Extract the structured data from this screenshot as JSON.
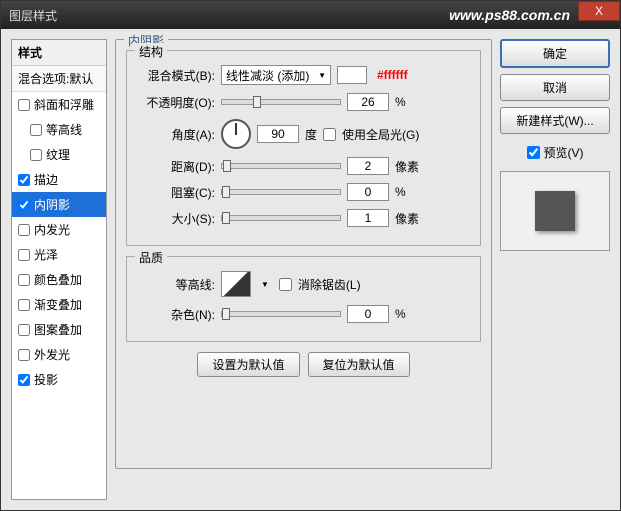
{
  "titlebar": {
    "title": "图层样式",
    "url": "www.ps88.com.cn",
    "close": "X"
  },
  "styles": {
    "header": "样式",
    "blend": "混合选项:默认",
    "items": [
      {
        "label": "斜面和浮雕",
        "checked": false,
        "indent": false
      },
      {
        "label": "等高线",
        "checked": false,
        "indent": true
      },
      {
        "label": "纹理",
        "checked": false,
        "indent": true
      },
      {
        "label": "描边",
        "checked": true,
        "indent": false
      },
      {
        "label": "内阴影",
        "checked": true,
        "indent": false,
        "selected": true
      },
      {
        "label": "内发光",
        "checked": false,
        "indent": false
      },
      {
        "label": "光泽",
        "checked": false,
        "indent": false
      },
      {
        "label": "颜色叠加",
        "checked": false,
        "indent": false
      },
      {
        "label": "渐变叠加",
        "checked": false,
        "indent": false
      },
      {
        "label": "图案叠加",
        "checked": false,
        "indent": false
      },
      {
        "label": "外发光",
        "checked": false,
        "indent": false
      },
      {
        "label": "投影",
        "checked": true,
        "indent": false
      }
    ]
  },
  "panel": {
    "title": "内阴影",
    "structure": {
      "title": "结构",
      "blend_label": "混合模式(B):",
      "blend_value": "线性减淡 (添加)",
      "hex": "#ffffff",
      "opacity_label": "不透明度(O):",
      "opacity_value": "26",
      "opacity_unit": "%",
      "angle_label": "角度(A):",
      "angle_value": "90",
      "angle_unit": "度",
      "global_label": "使用全局光(G)",
      "distance_label": "距离(D):",
      "distance_value": "2",
      "distance_unit": "像素",
      "choke_label": "阻塞(C):",
      "choke_value": "0",
      "choke_unit": "%",
      "size_label": "大小(S):",
      "size_value": "1",
      "size_unit": "像素"
    },
    "quality": {
      "title": "品质",
      "contour_label": "等高线:",
      "antialias_label": "消除锯齿(L)",
      "noise_label": "杂色(N):",
      "noise_value": "0",
      "noise_unit": "%"
    },
    "defaults": {
      "set": "设置为默认值",
      "reset": "复位为默认值"
    }
  },
  "right": {
    "ok": "确定",
    "cancel": "取消",
    "newstyle": "新建样式(W)...",
    "preview": "预览(V)"
  }
}
